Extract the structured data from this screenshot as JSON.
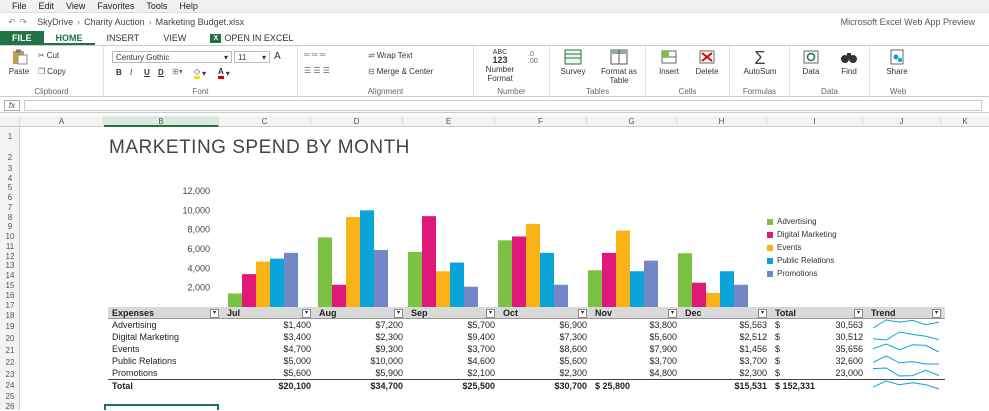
{
  "menu": [
    "File",
    "Edit",
    "View",
    "Favorites",
    "Tools",
    "Help"
  ],
  "breadcrumb": {
    "root": "SkyDrive",
    "folder": "Charity Auction",
    "file": "Marketing Budget.xlsx"
  },
  "app_title": "Microsoft Excel Web App Preview",
  "tabs": {
    "file": "FILE",
    "home": "HOME",
    "insert": "INSERT",
    "view": "VIEW",
    "open": "OPEN IN EXCEL"
  },
  "ribbon": {
    "cut": "Cut",
    "paste": "Paste",
    "copy": "Copy",
    "clipboard": "Clipboard",
    "font_name": "Century Gothic",
    "font_size": "11",
    "font": "Font",
    "bold": "B",
    "italic": "I",
    "underline": "U",
    "double_underline": "D",
    "wrap_text": "Wrap Text",
    "merge_center": "Merge & Center",
    "alignment": "Alignment",
    "number_format_top": "ABC",
    "number_format_mid": "123",
    "number_format": "Number Format",
    "number": "Number",
    "survey": "Survey",
    "format_as_table": "Format as Table",
    "tables": "Tables",
    "insert": "Insert",
    "delete": "Delete",
    "cells": "Cells",
    "autosum": "AutoSum",
    "formulas": "Formulas",
    "data": "Data",
    "find": "Find",
    "data_group": "Data",
    "share": "Share",
    "web": "Web"
  },
  "formula_bar": {
    "fx": "fx",
    "value": ""
  },
  "columns": [
    "A",
    "B",
    "C",
    "D",
    "E",
    "F",
    "G",
    "H",
    "I",
    "J",
    "K"
  ],
  "rows": [
    "1",
    "2",
    "3",
    "4",
    "5",
    "6",
    "7",
    "8",
    "9",
    "10",
    "11",
    "12",
    "13",
    "14",
    "15",
    "16",
    "17",
    "18",
    "19",
    "20",
    "21",
    "22",
    "23",
    "24",
    "25",
    "26"
  ],
  "sheet_title": "MARKETING SPEND BY MONTH",
  "table": {
    "headers": [
      "Expenses",
      "Jul",
      "Aug",
      "Sep",
      "Oct",
      "Nov",
      "Dec",
      "Total",
      "Trend"
    ],
    "rows": [
      [
        "Advertising",
        "$1,400",
        "$7,200",
        "$5,700",
        "$6,900",
        "$3,800",
        "$5,563",
        "$",
        "30,563"
      ],
      [
        "Digital Marketing",
        "$3,400",
        "$2,300",
        "$9,400",
        "$7,300",
        "$5,600",
        "$2,512",
        "$",
        "30,512"
      ],
      [
        "Events",
        "$4,700",
        "$9,300",
        "$3,700",
        "$8,600",
        "$7,900",
        "$1,456",
        "$",
        "35,656"
      ],
      [
        "Public Relations",
        "$5,000",
        "$10,000",
        "$4,600",
        "$5,600",
        "$3,700",
        "$3,700",
        "$",
        "32,600"
      ],
      [
        "Promotions",
        "$5,600",
        "$5,900",
        "$2,100",
        "$2,300",
        "$4,800",
        "$2,300",
        "$",
        "23,000"
      ]
    ],
    "total": [
      "Total",
      "$20,100",
      "$34,700",
      "$25,500",
      "$30,700",
      "$  25,800",
      "$15,531",
      "$ 152,331"
    ]
  },
  "chart_data": {
    "type": "bar",
    "categories": [
      "Jul",
      "Aug",
      "Sep",
      "Oct",
      "Nov",
      "Dec"
    ],
    "ylim": [
      0,
      12000
    ],
    "yticks": [
      "2,000",
      "4,000",
      "6,000",
      "8,000",
      "10,000",
      "12,000"
    ],
    "ytick_values": [
      2000,
      4000,
      6000,
      8000,
      10000,
      12000
    ],
    "series": [
      {
        "name": "Advertising",
        "color": "#7cc242",
        "values": [
          1400,
          7200,
          5700,
          6900,
          3800,
          5563
        ]
      },
      {
        "name": "Digital Marketing",
        "color": "#e0187a",
        "values": [
          3400,
          2300,
          9400,
          7300,
          5600,
          2512
        ]
      },
      {
        "name": "Events",
        "color": "#fbb216",
        "values": [
          4700,
          9300,
          3700,
          8600,
          7900,
          1456
        ]
      },
      {
        "name": "Public Relations",
        "color": "#0aa4d8",
        "values": [
          5000,
          10000,
          4600,
          5600,
          3700,
          3700
        ]
      },
      {
        "name": "Promotions",
        "color": "#7387c6",
        "values": [
          5600,
          5900,
          2100,
          2300,
          4800,
          2300
        ]
      }
    ],
    "legend_position": "right",
    "grid": false
  },
  "colors": {
    "accent": "#217346",
    "table_header": "#d9d9d9",
    "sparkline": "#0aa4d8"
  }
}
